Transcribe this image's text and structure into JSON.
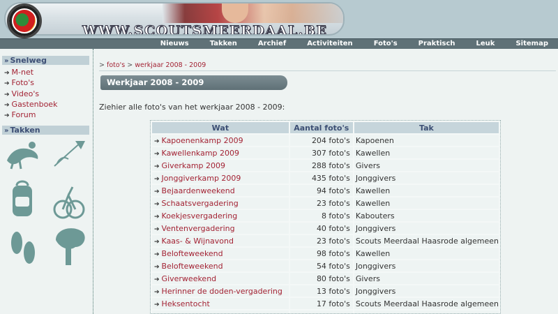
{
  "header": {
    "site_name": "WWW.SCOUTSMEERDAAL.BE",
    "logo_text": "SCOUTS MEERDAAL"
  },
  "nav": {
    "items": [
      "Nieuws",
      "Takken",
      "Archief",
      "Activiteiten",
      "Foto's",
      "Praktisch",
      "Leuk",
      "Sitemap"
    ]
  },
  "sidebar": {
    "snelweg": {
      "title": "Snelweg",
      "links": [
        "M-net",
        "Foto's",
        "Video's",
        "Gastenboek",
        "Forum"
      ]
    },
    "takken": {
      "title": "Takken",
      "icons": [
        "kapoenen-icon",
        "kawellen-icon",
        "givers-icon",
        "jonggivers-icon",
        "footprints-icon",
        "tree-icon"
      ]
    }
  },
  "breadcrumb": {
    "parts": [
      "foto's",
      "werkjaar 2008 - 2009"
    ]
  },
  "page": {
    "title": "Werkjaar 2008 - 2009",
    "intro": "Ziehier alle foto's van het werkjaar 2008 - 2009:"
  },
  "table": {
    "headers": [
      "Wat",
      "Aantal foto's",
      "Tak"
    ],
    "rows": [
      {
        "wat": "Kapoenenkamp 2009",
        "aantal": "204 foto's",
        "tak": "Kapoenen"
      },
      {
        "wat": "Kawellenkamp 2009",
        "aantal": "307 foto's",
        "tak": "Kawellen"
      },
      {
        "wat": "Giverkamp 2009",
        "aantal": "288 foto's",
        "tak": "Givers"
      },
      {
        "wat": "Jonggiverkamp 2009",
        "aantal": "435 foto's",
        "tak": "Jonggivers"
      },
      {
        "wat": "Bejaardenweekend",
        "aantal": "94 foto's",
        "tak": "Kawellen"
      },
      {
        "wat": "Schaatsvergadering",
        "aantal": "23 foto's",
        "tak": "Kawellen"
      },
      {
        "wat": "Koekjesvergadering",
        "aantal": "8 foto's",
        "tak": "Kabouters"
      },
      {
        "wat": "Ventenvergadering",
        "aantal": "40 foto's",
        "tak": "Jonggivers"
      },
      {
        "wat": "Kaas- & Wijnavond",
        "aantal": "23 foto's",
        "tak": "Scouts Meerdaal Haasrode algemeen"
      },
      {
        "wat": "Belofteweekend",
        "aantal": "98 foto's",
        "tak": "Kawellen"
      },
      {
        "wat": "Belofteweekend",
        "aantal": "54 foto's",
        "tak": "Jonggivers"
      },
      {
        "wat": "Giverweekend",
        "aantal": "80 foto's",
        "tak": "Givers"
      },
      {
        "wat": "Herinner de doden-vergadering",
        "aantal": "13 foto's",
        "tak": "Jonggivers"
      },
      {
        "wat": "Heksentocht",
        "aantal": "17 foto's",
        "tak": "Scouts Meerdaal Haasrode algemeen"
      },
      {
        "wat": "",
        "aantal": "",
        "tak": ""
      }
    ]
  },
  "colors": {
    "link": "#a32334",
    "navbar": "#5f7177",
    "header_bg": "#b7cad0",
    "table_header": "#c6d5db"
  }
}
